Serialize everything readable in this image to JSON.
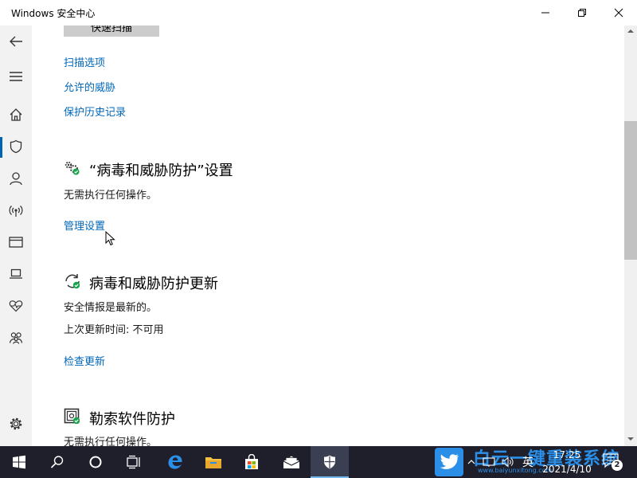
{
  "window": {
    "title": "Windows 安全中心"
  },
  "top_button": {
    "label": "快速扫描"
  },
  "links": {
    "scan_options": "扫描选项",
    "allowed_threats": "允许的威胁",
    "protection_history": "保护历史记录"
  },
  "settings_section": {
    "heading": "“病毒和威胁防护”设置",
    "status": "无需执行任何操作。",
    "link": "管理设置"
  },
  "updates_section": {
    "heading": "病毒和威胁防护更新",
    "status": "安全情报是最新的。",
    "last_update": "上次更新时间: 不可用",
    "link": "检查更新"
  },
  "ransomware_section": {
    "heading": "勒索软件防护",
    "status": "无需执行任何操作。"
  },
  "taskbar": {
    "ime": "英",
    "time": "17:25",
    "date": "2021/4/10",
    "notification_count": "2",
    "watermark_text": "白云一键重装系统",
    "watermark_url": "www.baiyunxitong.com"
  },
  "colors": {
    "accent": "#0063b1",
    "link": "#0067b8",
    "taskbar": "#1f1f2b"
  }
}
